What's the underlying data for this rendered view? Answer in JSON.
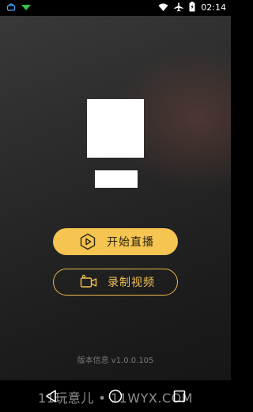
{
  "status_bar": {
    "time": "02:14",
    "icons": [
      "android-debug-icon",
      "wifi-signal-icon",
      "wifi-icon",
      "airplane-mode-icon",
      "battery-icon"
    ]
  },
  "header_image": {
    "logo_icon": "white-square-logo",
    "name_icon": "white-rect-name"
  },
  "buttons": {
    "start_live": {
      "label": "开始直播",
      "icon": "play-hexagon-icon",
      "color": "#f5c451"
    },
    "record_video": {
      "label": "录制视频",
      "icon": "video-camera-icon",
      "color": "#f0c050"
    }
  },
  "footer": {
    "version_text": "版本信息 v1.0.0.105",
    "watermark": "11玩意儿 • 11WYX.COM"
  },
  "nav_bar": {
    "icons": [
      "back-icon",
      "home-icon",
      "recents-icon"
    ]
  }
}
